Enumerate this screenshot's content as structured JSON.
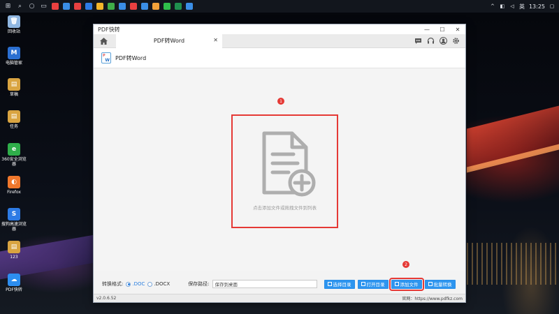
{
  "taskbar": {
    "clock": "13:25",
    "ime": "英",
    "apps": [
      {
        "icon": "app-icon-1",
        "color": "#e94040"
      },
      {
        "icon": "app-icon-2",
        "color": "#3a8ee6"
      },
      {
        "icon": "app-icon-3",
        "color": "#e94040"
      },
      {
        "icon": "app-icon-4",
        "color": "#2d7be5"
      },
      {
        "icon": "chrome-icon",
        "color": "#f2b52a"
      },
      {
        "icon": "app-icon-6",
        "color": "#3fae49"
      },
      {
        "icon": "app-icon-7",
        "color": "#3a8ee6"
      },
      {
        "icon": "app-icon-8",
        "color": "#e94040"
      },
      {
        "icon": "app-icon-9",
        "color": "#3a8ee6"
      },
      {
        "icon": "app-icon-10",
        "color": "#f2a23a"
      },
      {
        "icon": "wechat-icon",
        "color": "#2fbf4b"
      },
      {
        "icon": "excel-icon",
        "color": "#1f8f4e"
      },
      {
        "icon": "app-icon-13",
        "color": "#3a8ee6"
      }
    ]
  },
  "desktop": {
    "icons": [
      {
        "label": "回收站",
        "name": "desktop-icon-recycle-bin",
        "color": "#8fb6e0",
        "glyph": "🗑"
      },
      {
        "label": "电脑管家",
        "name": "desktop-icon-pc-manager",
        "color": "#2b6fd1",
        "glyph": "M"
      },
      {
        "label": "草稿",
        "name": "desktop-icon-draft",
        "color": "#d9a441",
        "glyph": "▤"
      },
      {
        "label": "任务",
        "name": "desktop-icon-tasks",
        "color": "#d9a441",
        "glyph": "▤"
      },
      {
        "label": "360安全浏览器",
        "name": "desktop-icon-360-browser",
        "color": "#2fae4a",
        "glyph": "e"
      },
      {
        "label": "Firefox",
        "name": "desktop-icon-firefox",
        "color": "#f0772c",
        "glyph": "◐"
      },
      {
        "label": "搜狗高速浏览器",
        "name": "desktop-icon-sogou-browser",
        "color": "#2d7be5",
        "glyph": "S"
      },
      {
        "label": "123",
        "name": "desktop-icon-123",
        "color": "#d9a441",
        "glyph": "▤"
      },
      {
        "label": "PDF快转",
        "name": "desktop-icon-pdf-converter",
        "color": "#2d8ef0",
        "glyph": "☁"
      }
    ]
  },
  "window": {
    "title": "PDF快转",
    "tab_label": "PDF转Word",
    "subheader_title": "PDF转Word",
    "drop_hint": "点击添加文件或拖拽文件到列表",
    "marker_1": "1",
    "marker_2": "2",
    "format_label": "转换格式:",
    "format_options": [
      ".DOC",
      ".DOCX"
    ],
    "selected_format": ".DOC",
    "save_label": "保存路径:",
    "save_path": "保存到桌面",
    "buttons": {
      "choose_dir": "选择目录",
      "open_dir": "打开目录",
      "add_file": "添加文件",
      "batch_convert": "批量转换"
    },
    "version": "v2.0.6.52",
    "website": "官网：https://www.pdfkz.com"
  }
}
